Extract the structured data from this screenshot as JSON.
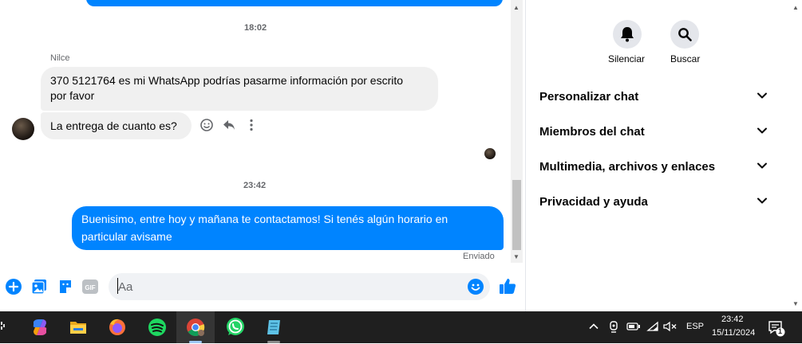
{
  "chat": {
    "timestamps": [
      "18:02",
      "23:42"
    ],
    "sender_name": "Nilce",
    "incoming_messages": [
      {
        "line1": "370 5121764 es mi WhatsApp podrías pasarme información por escrito",
        "line2": "por favor"
      },
      {
        "line1": "La entrega de cuanto es?"
      }
    ],
    "outgoing_message": {
      "line1": "Buenisimo, entre hoy y mañana te contactamos! Si tenés algún horario en",
      "line2": "particular avisame"
    },
    "status": "Enviado"
  },
  "composer": {
    "placeholder": "Aa",
    "gif_label": "GIF"
  },
  "side_panel": {
    "buttons": [
      {
        "label": "Silenciar",
        "icon": "bell-icon"
      },
      {
        "label": "Buscar",
        "icon": "search-icon"
      }
    ],
    "sections": [
      "Personalizar chat",
      "Miembros del chat",
      "Multimedia, archivos y enlaces",
      "Privacidad y ayuda"
    ]
  },
  "taskbar": {
    "apps": [
      "copilot-icon",
      "file-explorer-icon",
      "firefox-icon",
      "spotify-icon",
      "chrome-icon",
      "whatsapp-icon",
      "notepad-icon"
    ],
    "language": "ESP",
    "time": "23:42",
    "date": "15/11/2024",
    "notification_count": "1"
  },
  "colors": {
    "accent": "#0084ff",
    "bubble_gray": "#f0f0f0",
    "taskbar": "#1f1f1f"
  }
}
